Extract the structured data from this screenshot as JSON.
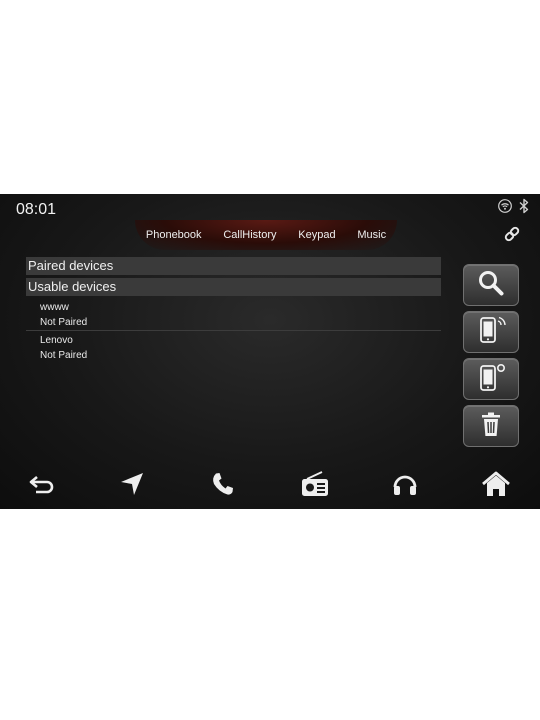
{
  "status_bar": {
    "time": "08:01",
    "icons": [
      "wifi-icon",
      "bluetooth-icon"
    ]
  },
  "tabs": [
    {
      "label": "Phonebook"
    },
    {
      "label": "CallHistory"
    },
    {
      "label": "Keypad"
    },
    {
      "label": "Music"
    }
  ],
  "sections": {
    "paired": "Paired devices",
    "usable": "Usable devices"
  },
  "devices": [
    {
      "name": "wwww",
      "status": "Not Paired"
    },
    {
      "name": "Lenovo",
      "status": "Not Paired"
    }
  ],
  "side_actions": [
    "search-icon",
    "phone-connect-icon",
    "phone-settings-icon",
    "trash-icon"
  ],
  "bottom_nav": [
    "back-icon",
    "navigation-icon",
    "phone-icon",
    "radio-icon",
    "headphones-icon",
    "home-icon"
  ],
  "colors": {
    "background": "#181818",
    "tab_glow": "#5a1a14",
    "section_bar": "#3a3a3a",
    "text": "#f0f0f0"
  }
}
